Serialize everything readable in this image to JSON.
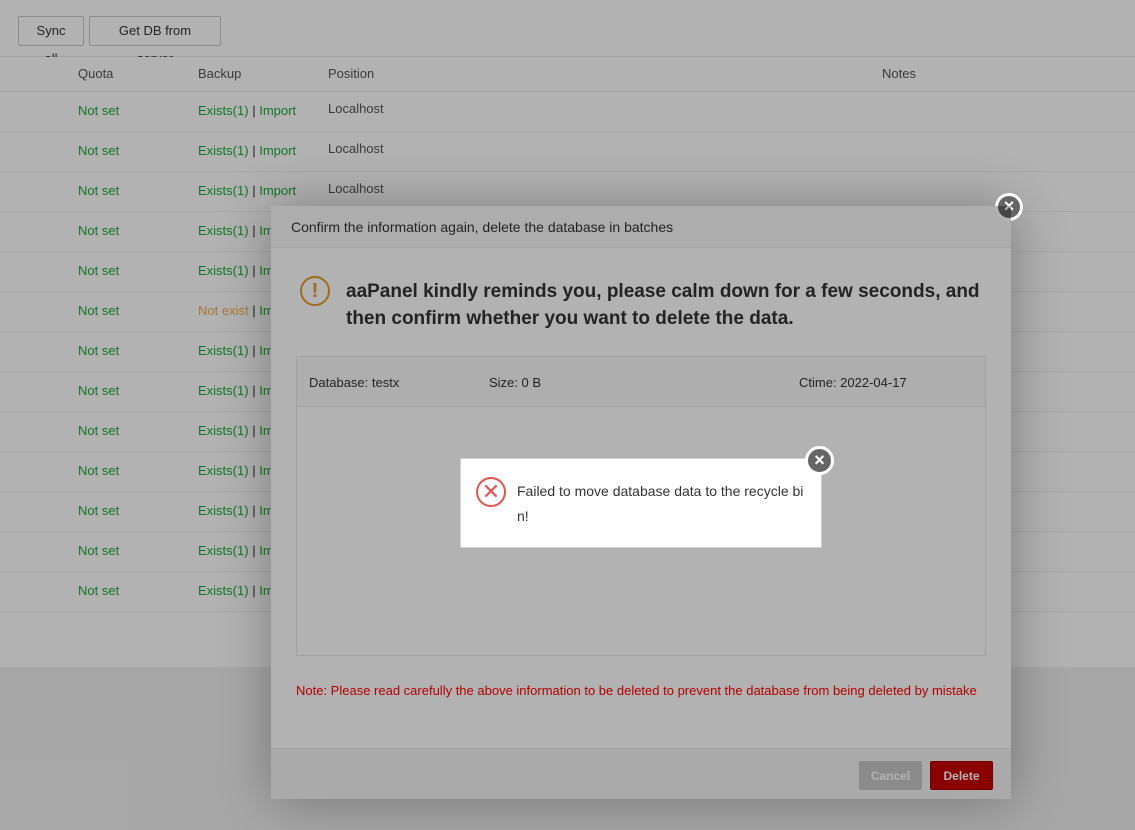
{
  "toolbar": {
    "sync_all": "Sync all",
    "get_db": "Get DB from server"
  },
  "table": {
    "headers": {
      "quota": "Quota",
      "backup": "Backup",
      "position": "Position",
      "notes": "Notes"
    },
    "rows": [
      {
        "quota": "Not set",
        "backup": "Exists(1)",
        "import": "Import",
        "position": "Localhost"
      },
      {
        "quota": "Not set",
        "backup": "Exists(1)",
        "import": "Import",
        "position": "Localhost"
      },
      {
        "quota": "Not set",
        "backup": "Exists(1)",
        "import": "Import",
        "position": "Localhost"
      },
      {
        "quota": "Not set",
        "backup": "Exists(1)",
        "import": "Im",
        "position": ""
      },
      {
        "quota": "Not set",
        "backup": "Exists(1)",
        "import": "Im",
        "position": ""
      },
      {
        "quota": "Not set",
        "backup": "Not exist",
        "import": "Im",
        "position": ""
      },
      {
        "quota": "Not set",
        "backup": "Exists(1)",
        "import": "Im",
        "position": ""
      },
      {
        "quota": "Not set",
        "backup": "Exists(1)",
        "import": "Im",
        "position": ""
      },
      {
        "quota": "Not set",
        "backup": "Exists(1)",
        "import": "Im",
        "position": ""
      },
      {
        "quota": "Not set",
        "backup": "Exists(1)",
        "import": "Im",
        "position": ""
      },
      {
        "quota": "Not set",
        "backup": "Exists(1)",
        "import": "Im",
        "position": ""
      },
      {
        "quota": "Not set",
        "backup": "Exists(1)",
        "import": "Im",
        "position": ""
      },
      {
        "quota": "Not set",
        "backup": "Exists(1)",
        "import": "Im",
        "position": ""
      }
    ],
    "separator": "|"
  },
  "dialog": {
    "title": "Confirm the information again, delete the database in batches",
    "warning_icon": "!",
    "warning": "aaPanel kindly reminds you, please calm down for a few seconds, and then confirm whether you want to delete the data.",
    "database": "Database: testx",
    "size": "Size: 0 B",
    "ctime": "Ctime:  2022-04-17",
    "note": "Note: Please read carefully the above information to be deleted to prevent the database from being deleted by mistake",
    "cancel": "Cancel",
    "delete": "Delete",
    "close_glyph": "×"
  },
  "toast": {
    "message": "Failed to move database data to the recycle bin!",
    "error_glyph": "✕",
    "close_glyph": "×"
  },
  "colors": {
    "green": "#20a53a",
    "orange": "#f0ad4e",
    "danger": "#c80000",
    "warning": "#e39b26"
  }
}
